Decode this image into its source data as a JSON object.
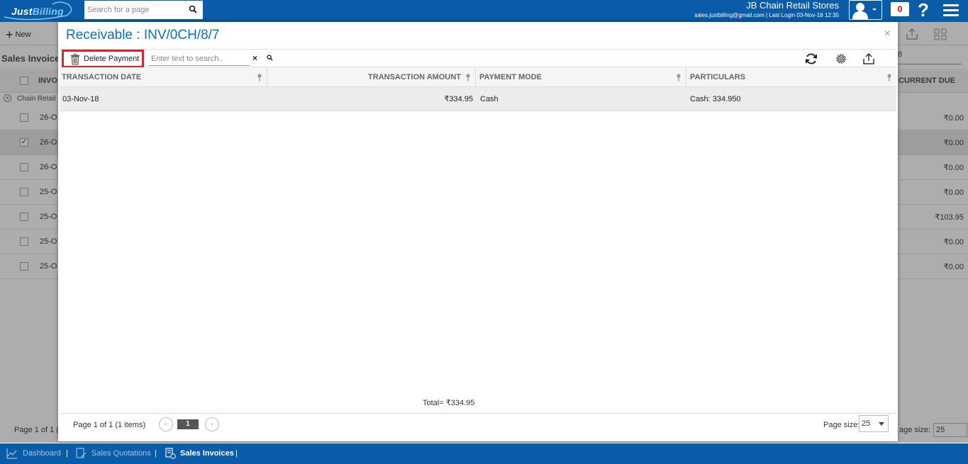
{
  "app": {
    "logo_part1": "Just",
    "logo_part2": "Billing",
    "search_placeholder": "Search for a page",
    "store_name": "JB Chain Retail Stores",
    "login_info": "sales.justbilling@gmail.com | Last Login 03-Nov-18 12:35",
    "notification_count": "0",
    "help_label": "?"
  },
  "background": {
    "new_label": "New",
    "page_title": "Sales Invoices",
    "col_invoice": "INVO",
    "col_current_due": "CURRENT DUE",
    "group_label": "Chain Retail",
    "date_filter": "8",
    "rows": [
      {
        "date": "26-O",
        "due": "₹0.00",
        "checked": false
      },
      {
        "date": "26-O",
        "due": "₹0.00",
        "checked": true
      },
      {
        "date": "26-O",
        "due": "₹0.00",
        "checked": false
      },
      {
        "date": "25-O",
        "due": "₹0.00",
        "checked": false
      },
      {
        "date": "25-O",
        "due": "₹103.95",
        "checked": false
      },
      {
        "date": "25-O",
        "due": "₹0.00",
        "checked": false
      },
      {
        "date": "25-O",
        "due": "₹0.00",
        "checked": false
      }
    ],
    "footer_page": "Page 1 of 1 (",
    "footer_pagesize": "age size:",
    "footer_pagesize_value": "25"
  },
  "modal": {
    "title": "Receivable : INV/0CH/8/7",
    "close": "×",
    "delete_label": "Delete Payment",
    "search_placeholder": "Enter text to search..",
    "clear": "×",
    "columns": {
      "date": "TRANSACTION DATE",
      "amount": "TRANSACTION AMOUNT",
      "mode": "PAYMENT MODE",
      "particulars": "PARTICULARS"
    },
    "rows": [
      {
        "date": "03-Nov-18",
        "amount": "₹334.95",
        "mode": "Cash",
        "particulars": "Cash: 334.950"
      }
    ],
    "total": "Total= ₹334.95",
    "pager_info": "Page 1 of 1 (1 items)",
    "current_page": "1",
    "page_size_label": "Page size:",
    "page_size_value": "25"
  },
  "taskbar": {
    "items": [
      {
        "label": "Dashboard",
        "active": false
      },
      {
        "label": "Sales Quotations",
        "active": false
      },
      {
        "label": "Sales Invoices",
        "active": true
      }
    ],
    "separator": "|"
  },
  "colors": {
    "brand_blue": "#0a5ca8",
    "title_blue": "#0a72c0",
    "highlight_red": "#d9232d"
  }
}
